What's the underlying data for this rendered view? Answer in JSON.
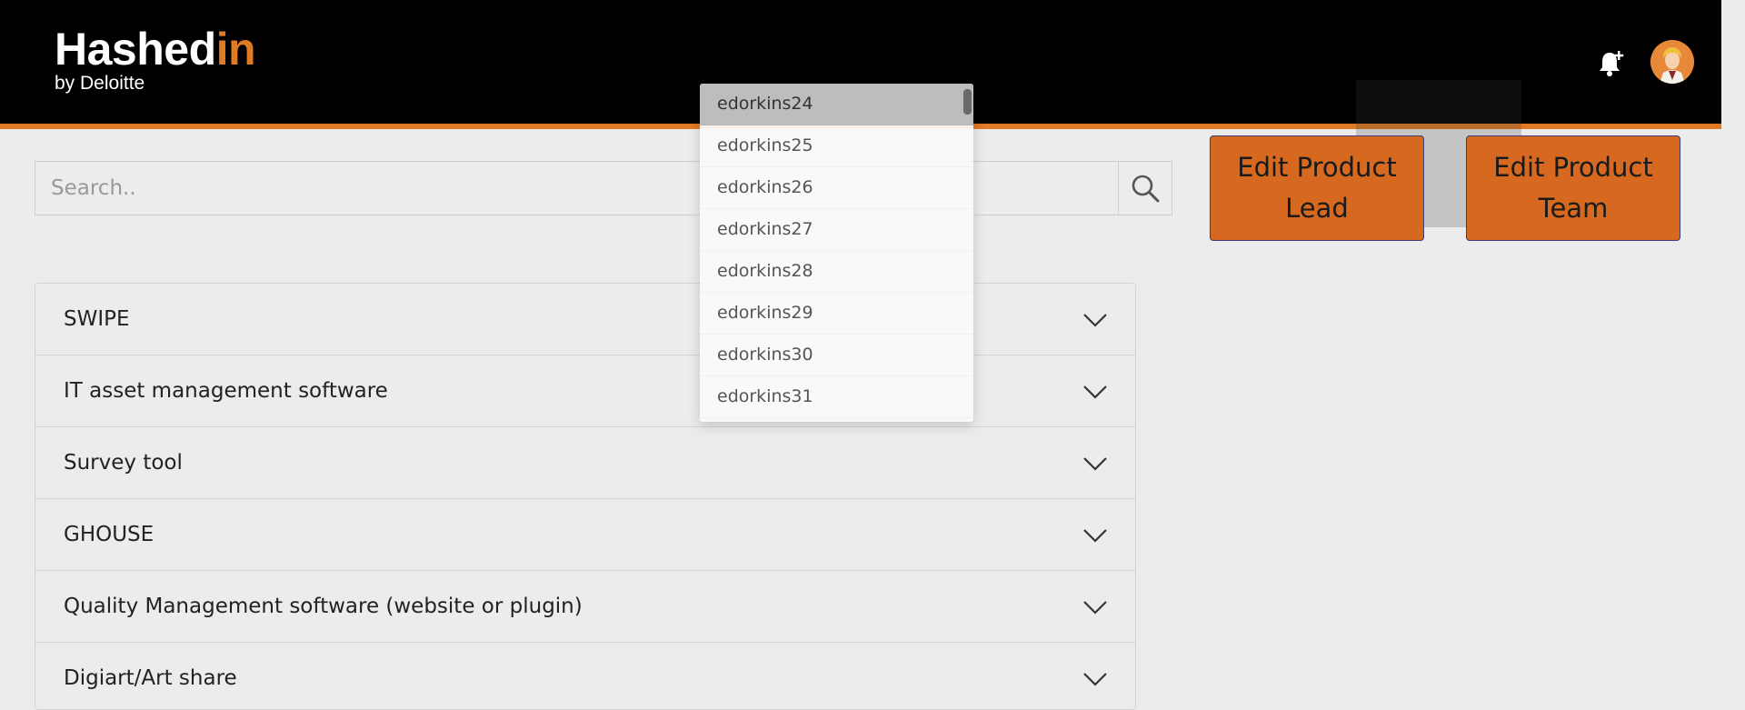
{
  "header": {
    "logo_main_prefix": "Hashed",
    "logo_main_accent": "in",
    "logo_sub": "by Deloitte",
    "notification_icon": "bell-plus-icon",
    "avatar_icon": "user-avatar-icon"
  },
  "colors": {
    "accent": "#e07a25",
    "button": "#d6691f",
    "header_bg": "#000000",
    "page_bg": "#ececec"
  },
  "search": {
    "placeholder": "Search..",
    "value": "",
    "icon": "search-icon"
  },
  "buttons": {
    "edit_lead": "Edit Product Lead",
    "edit_team": "Edit Product Team"
  },
  "dropdown": {
    "items": [
      "edorkins24",
      "edorkins25",
      "edorkins26",
      "edorkins27",
      "edorkins28",
      "edorkins29",
      "edorkins30",
      "edorkins31"
    ],
    "selected": "edorkins24"
  },
  "products": [
    {
      "label": "SWIPE"
    },
    {
      "label": "IT asset management software"
    },
    {
      "label": "Survey tool"
    },
    {
      "label": "GHOUSE"
    },
    {
      "label": "Quality Management software (website or plugin)"
    },
    {
      "label": "Digiart/Art share"
    }
  ]
}
